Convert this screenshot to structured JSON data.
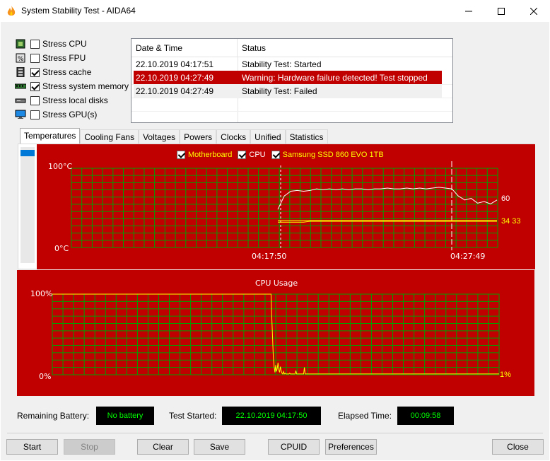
{
  "window": {
    "title": "System Stability Test - AIDA64",
    "minimize_glyph": "—",
    "maximize_glyph": "☐",
    "close_glyph": "✕"
  },
  "options": [
    {
      "label": "Stress CPU",
      "checked": false,
      "icon": "cpu-chip-icon"
    },
    {
      "label": "Stress FPU",
      "checked": false,
      "icon": "fpu-icon"
    },
    {
      "label": "Stress cache",
      "checked": true,
      "icon": "cache-icon"
    },
    {
      "label": "Stress system memory",
      "checked": true,
      "icon": "memory-module-icon"
    },
    {
      "label": "Stress local disks",
      "checked": false,
      "icon": "disk-drive-icon"
    },
    {
      "label": "Stress GPU(s)",
      "checked": false,
      "icon": "monitor-icon"
    }
  ],
  "log": {
    "headers": [
      "Date & Time",
      "Status"
    ],
    "rows": [
      {
        "time": "22.10.2019 04:17:51",
        "status": "Stability Test: Started",
        "style": "normal"
      },
      {
        "time": "22.10.2019 04:27:49",
        "status": "Warning: Hardware failure detected! Test stopped",
        "style": "warn"
      },
      {
        "time": "22.10.2019 04:27:49",
        "status": "Stability Test: Failed",
        "style": "alt"
      }
    ]
  },
  "tabs": [
    "Temperatures",
    "Cooling Fans",
    "Voltages",
    "Powers",
    "Clocks",
    "Unified",
    "Statistics"
  ],
  "active_tab": "Temperatures",
  "temperature_chart": {
    "legend": [
      {
        "label": "Motherboard",
        "checked": true,
        "color": "#ffff00"
      },
      {
        "label": "CPU",
        "checked": true,
        "color": "#ffffff"
      },
      {
        "label": "Samsung SSD 860 EVO 1TB",
        "checked": true,
        "color": "#ffff00"
      }
    ],
    "y_max_label": "100°C",
    "y_min_label": "0°C",
    "x_labels": [
      "04:17:50",
      "04:27:49"
    ],
    "cpu_value_label": "60",
    "other_value_label": "34 33",
    "background": "#c00000",
    "grid_color": "#00a000"
  },
  "cpu_chart": {
    "title": "CPU Usage",
    "y_max_label": "100%",
    "y_min_label": "0%",
    "value_label": "1%",
    "line_color": "#ffff00"
  },
  "chart_data": [
    {
      "type": "line",
      "title": "",
      "ylim": [
        0,
        100
      ],
      "x_ticks": [
        "04:17:50",
        "04:27:49"
      ],
      "series": [
        {
          "name": "CPU",
          "color": "#ffffff",
          "values": [
            48,
            65,
            71,
            72,
            71,
            72,
            74,
            73,
            74,
            73,
            74,
            73,
            74,
            74,
            73,
            74,
            74,
            75,
            74,
            74,
            75,
            74,
            75,
            74,
            75,
            76,
            75,
            74,
            65,
            60,
            62,
            56,
            58,
            55,
            60
          ]
        },
        {
          "name": "Motherboard",
          "color": "#ffff00",
          "values": [
            34,
            34,
            34,
            34,
            34,
            34,
            34,
            34,
            34,
            34,
            34,
            34,
            34,
            34,
            34,
            34,
            34,
            34,
            34,
            34,
            34,
            34,
            34,
            34,
            34,
            34,
            34,
            34,
            34,
            34,
            34,
            34,
            34,
            34,
            34
          ]
        },
        {
          "name": "Samsung SSD 860 EVO 1TB",
          "color": "#ffff00",
          "values": [
            32,
            32,
            32,
            32,
            32,
            33,
            33,
            33,
            33,
            33,
            33,
            33,
            33,
            33,
            33,
            33,
            33,
            33,
            33,
            33,
            33,
            33,
            33,
            33,
            33,
            33,
            33,
            33,
            33,
            33,
            33,
            33,
            33,
            33,
            33
          ]
        }
      ]
    },
    {
      "type": "line",
      "title": "CPU Usage",
      "ylim": [
        0,
        100
      ],
      "series": [
        {
          "name": "CPU Usage",
          "color": "#ffff00",
          "values": [
            100,
            100,
            100,
            100,
            100,
            100,
            100,
            100,
            100,
            100,
            100,
            100,
            100,
            100,
            100,
            100,
            100,
            100,
            100,
            100,
            100,
            100,
            100,
            100,
            100,
            100,
            100,
            100,
            100,
            100,
            100,
            100,
            100,
            100,
            100,
            100,
            100,
            100,
            100,
            100,
            100,
            100,
            100,
            100,
            100,
            100,
            100,
            100,
            100,
            100,
            100,
            100,
            100,
            100,
            100,
            100,
            100,
            100,
            100,
            100,
            100,
            100,
            100,
            100,
            100,
            100,
            100,
            100,
            100,
            100,
            100,
            100,
            100,
            100,
            100,
            100,
            100,
            100,
            100,
            100,
            100,
            100,
            100,
            100,
            100,
            100,
            100,
            100,
            100,
            100,
            100,
            100,
            100,
            100,
            100,
            100,
            100,
            100,
            100,
            100,
            100,
            100,
            100,
            100,
            100,
            100,
            100,
            100,
            100,
            100,
            100,
            100,
            100,
            100,
            100,
            100,
            100,
            100,
            100,
            100,
            100,
            100,
            100,
            100,
            100,
            100,
            100,
            100,
            100,
            100,
            100,
            100,
            100,
            100,
            100,
            100,
            100,
            100,
            100,
            100,
            100,
            100,
            100,
            100,
            100,
            100,
            100,
            100,
            100,
            100,
            100,
            100,
            100,
            100,
            100,
            100,
            100,
            100,
            100,
            100,
            100,
            100,
            100,
            100,
            100,
            100,
            100,
            100,
            100,
            100,
            100,
            100,
            100,
            100,
            100,
            100,
            100,
            100,
            100,
            100,
            100,
            100,
            100,
            100,
            100,
            100,
            100,
            100,
            100,
            100,
            100,
            100,
            100,
            100,
            100,
            100,
            100,
            100,
            100,
            100,
            100,
            100,
            100,
            100,
            100,
            100,
            100,
            100,
            100,
            100,
            100,
            100,
            100,
            100,
            100,
            100,
            100,
            100,
            100,
            100,
            100,
            100,
            100,
            100,
            100,
            100,
            100,
            100,
            100,
            100,
            100,
            100,
            100,
            100,
            100,
            100,
            100,
            100,
            100,
            100,
            100,
            100,
            100,
            100,
            100,
            100,
            100,
            100,
            100,
            100,
            100,
            100,
            100,
            100,
            100,
            100,
            100,
            100,
            100,
            100,
            100,
            100,
            100,
            100,
            100,
            100,
            100,
            100,
            100,
            100,
            100,
            100,
            100,
            100,
            100,
            100,
            100,
            100,
            100,
            100,
            100,
            100,
            100,
            70,
            45,
            20,
            10,
            3,
            12,
            4,
            8,
            15,
            6,
            3,
            10,
            5,
            2,
            1,
            4,
            1,
            2,
            1,
            1,
            1,
            1,
            1,
            2,
            1,
            1,
            1,
            1,
            1,
            1,
            1,
            5,
            1,
            1,
            1,
            1,
            1,
            1,
            1,
            1,
            1,
            1,
            9,
            1,
            1,
            1,
            1,
            1,
            1,
            1,
            1,
            1,
            1,
            1,
            1,
            1,
            1,
            1,
            1,
            1,
            1,
            1,
            1,
            1,
            1,
            1,
            1,
            1,
            1,
            1,
            1,
            1,
            1,
            1,
            1,
            1,
            1,
            1,
            1,
            1,
            1,
            1,
            1,
            1,
            1,
            1,
            1,
            1,
            1,
            1,
            1,
            1,
            1,
            1,
            1,
            1,
            1,
            1,
            1,
            1,
            1,
            1,
            1,
            1,
            1,
            1,
            1,
            1,
            1,
            1,
            1,
            1,
            1,
            1,
            1,
            1,
            1,
            1,
            1,
            1,
            1,
            1,
            1,
            1,
            1,
            1,
            1,
            1,
            1,
            1,
            1,
            1,
            1,
            1,
            1,
            1,
            1,
            1,
            1,
            1,
            1,
            1,
            1,
            1,
            1,
            1,
            1,
            1,
            1,
            1,
            1,
            1,
            1,
            1,
            1,
            1,
            1,
            1,
            1,
            1,
            1,
            1,
            1,
            1,
            1,
            1,
            1,
            1,
            1,
            1,
            1,
            1,
            1,
            1,
            1,
            1,
            1,
            1,
            1,
            1,
            1,
            1,
            1,
            1,
            1,
            1,
            1,
            1,
            1,
            1,
            1,
            1,
            1,
            1,
            1,
            1,
            1,
            1,
            1,
            1,
            1,
            1,
            1,
            1,
            1,
            1,
            1,
            1,
            1,
            1,
            1,
            1,
            1,
            1,
            1,
            1,
            1,
            1,
            1,
            1,
            1,
            1,
            1,
            1,
            1,
            1,
            1,
            1,
            1,
            1,
            1,
            1,
            1,
            1,
            1,
            1,
            1,
            1,
            1,
            1,
            1,
            1,
            1,
            1,
            1,
            1,
            1,
            1,
            1,
            1,
            1,
            1,
            1,
            1,
            1,
            1,
            1,
            1,
            1,
            1,
            1,
            1,
            1,
            1,
            1,
            1,
            1,
            1,
            1,
            1,
            1,
            1,
            1,
            1,
            1,
            1,
            1,
            1,
            1,
            1,
            1,
            1,
            1,
            1,
            1,
            1,
            1,
            1,
            1,
            1,
            1,
            1,
            1,
            1
          ]
        }
      ]
    }
  ],
  "status": {
    "battery_label": "Remaining Battery:",
    "battery_value": "No battery",
    "started_label": "Test Started:",
    "started_value": "22.10.2019 04:17:50",
    "elapsed_label": "Elapsed Time:",
    "elapsed_value": "00:09:58"
  },
  "buttons": {
    "start": "Start",
    "stop": "Stop",
    "clear": "Clear",
    "save": "Save",
    "cpuid": "CPUID",
    "preferences": "Preferences",
    "close": "Close"
  }
}
